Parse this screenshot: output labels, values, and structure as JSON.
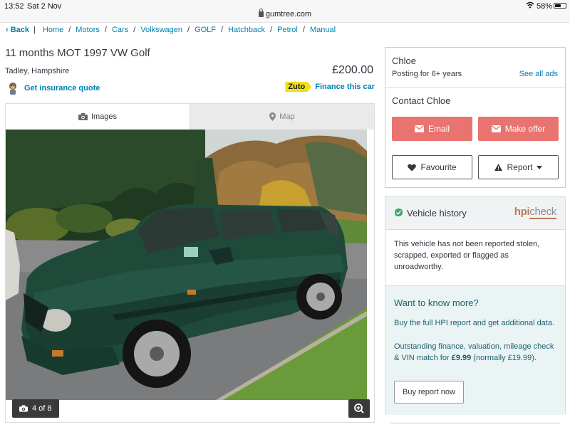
{
  "status_bar": {
    "time": "13:52",
    "date": "Sat 2 Nov",
    "url": "gumtree.com",
    "battery_pct": "58%",
    "battery_level": 0.58
  },
  "breadcrumb": {
    "back": "Back",
    "items": [
      "Home",
      "Motors",
      "Cars",
      "Volkswagen",
      "GOLF",
      "Hatchback",
      "Petrol",
      "Manual"
    ]
  },
  "listing": {
    "title": "11 months MOT 1997 VW Golf",
    "location": "Tadley, Hampshire",
    "price": "£200.00",
    "insurance_link": "Get insurance quote",
    "finance_brand": "Zuto",
    "finance_link": "Finance this car"
  },
  "gallery": {
    "tab_images": "Images",
    "tab_map": "Map",
    "counter": "4 of 8"
  },
  "seller": {
    "name": "Chloe",
    "posting": "Posting for 6+ years",
    "see_all": "See all ads",
    "contact_title": "Contact Chloe",
    "email_label": "Email",
    "offer_label": "Make offer",
    "favourite_label": "Favourite",
    "report_label": "Report"
  },
  "hpi": {
    "title": "Vehicle history",
    "logo_hpi": "hpi",
    "logo_check": "check",
    "status_text": "This vehicle has not been reported stolen, scrapped, exported or flagged as unroadworthy.",
    "want_more": "Want to know more?",
    "buy_text": "Buy the full HPI report and get additional data.",
    "outstanding_pre": "Outstanding finance, valuation, mileage check & VIN match for ",
    "outstanding_price": "£9.99",
    "outstanding_post": " (normally £19.99).",
    "buy_button": "Buy report now"
  },
  "colors": {
    "link": "#007fb0",
    "cta_red": "#e8736f",
    "hpi_teal": "#1c5f71",
    "zuto_yellow": "#f0e01c"
  }
}
